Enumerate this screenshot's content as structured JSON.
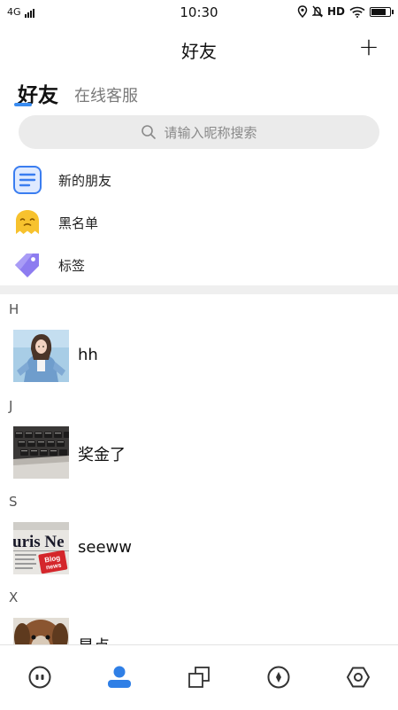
{
  "status_bar": {
    "network": "4G",
    "time": "10:30",
    "hd": "HD",
    "battery_level": 0.8
  },
  "header": {
    "title": "好友",
    "add_label": "+"
  },
  "tabs": [
    {
      "label": "好友",
      "active": true
    },
    {
      "label": "在线客服",
      "active": false
    }
  ],
  "search": {
    "placeholder": "请输入昵称搜索"
  },
  "menu": [
    {
      "label": "新的朋友",
      "icon": "new-friends-icon"
    },
    {
      "label": "黑名单",
      "icon": "blacklist-icon"
    },
    {
      "label": "标签",
      "icon": "tag-icon"
    }
  ],
  "sections": [
    {
      "letter": "H",
      "contacts": [
        {
          "name": "hh"
        }
      ]
    },
    {
      "letter": "J",
      "contacts": [
        {
          "name": "奖金了"
        }
      ]
    },
    {
      "letter": "S",
      "contacts": [
        {
          "name": "seeww"
        }
      ]
    },
    {
      "letter": "X",
      "contacts": [
        {
          "name": "星点"
        }
      ]
    }
  ],
  "avatar_text": {
    "newspaper": "uris Ne",
    "sticker_line1": "Blog",
    "sticker_line2": "news"
  },
  "bottom_nav": [
    {
      "icon": "chat-icon",
      "active": false
    },
    {
      "icon": "contacts-icon",
      "active": true
    },
    {
      "icon": "apps-icon",
      "active": false
    },
    {
      "icon": "discover-icon",
      "active": false
    },
    {
      "icon": "profile-icon",
      "active": false
    }
  ],
  "colors": {
    "accent": "#3a8cf0",
    "active_nav": "#2f7fe6",
    "inactive_nav": "#333333",
    "search_bg": "#ebebeb"
  }
}
